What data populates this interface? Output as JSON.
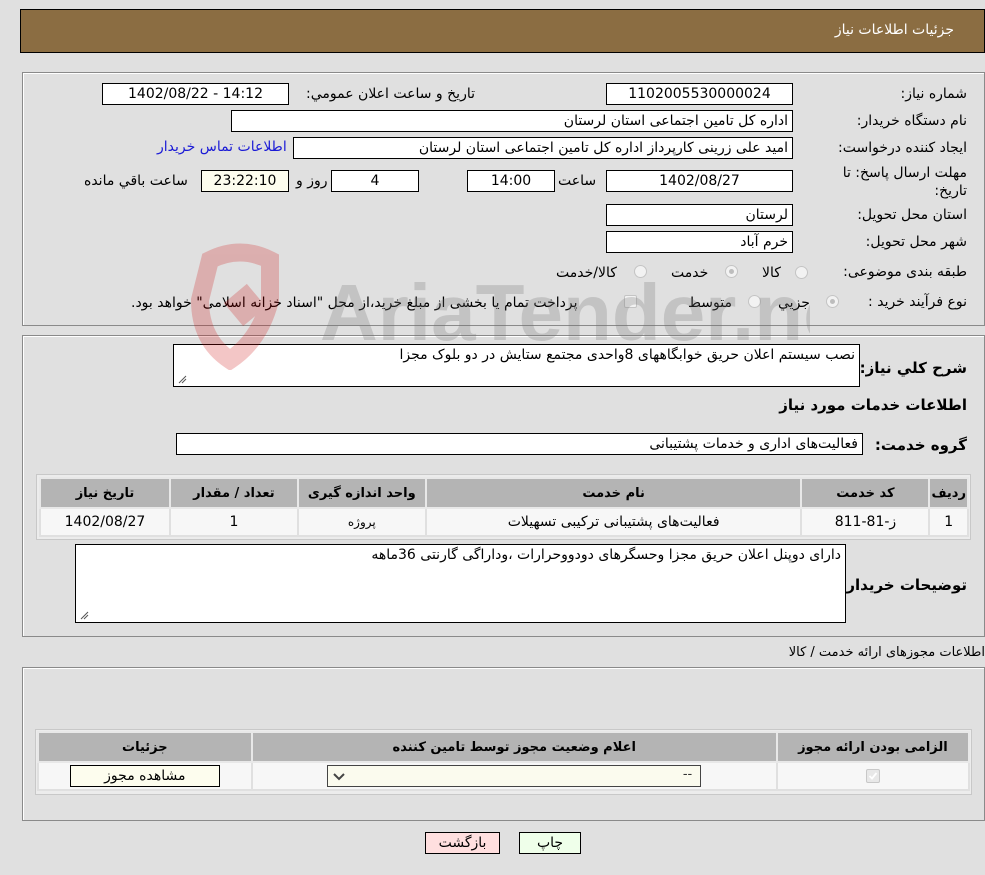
{
  "header": {
    "title": "جزئیات اطلاعات نیاز"
  },
  "form": {
    "need_number_label": "شماره نیاز:",
    "need_number": "1102005530000024",
    "announce_label": "تاریخ و ساعت اعلان عمومي:",
    "announce_value": "1402/08/22 - 14:12",
    "buyer_org_label": "نام دستگاه خريدار:",
    "buyer_org": "اداره کل تامین اجتماعی استان لرستان",
    "requester_label": "ايجاد کننده درخواست:",
    "requester": "امید علی زرینی کارپرداز اداره کل تامین اجتماعی استان لرستان",
    "buyer_contact_link": "اطلاعات تماس خريدار",
    "deadline_label": "مهلت ارسال پاسخ: تا تاریخ:",
    "deadline_date": "1402/08/27",
    "time_label": "ساعت",
    "deadline_time": "14:00",
    "days_value": "4",
    "days_label": "روز و",
    "remaining_time": "23:22:10",
    "remaining_label": "ساعت باقي مانده",
    "province_label": "استان محل تحويل:",
    "province": "لرستان",
    "city_label": "شهر محل تحويل:",
    "city": "خرم آباد",
    "category_label": "طبقه بندی موضوعی:",
    "category_options": [
      {
        "label": "کالا",
        "checked": false
      },
      {
        "label": "خدمت",
        "checked": true
      },
      {
        "label": "کالا/خدمت",
        "checked": false
      }
    ],
    "purchase_type_label": "نوع فرآيند خريد :",
    "purchase_options": [
      {
        "label": "جزيي",
        "checked": true
      },
      {
        "label": "متوسط",
        "checked": false
      }
    ],
    "treasury_note": "پرداخت تمام یا بخشی از مبلغ خرید،از محل \"اسناد خزانه اسلامی\" خواهد بود.",
    "treasury_checked": false
  },
  "details": {
    "summary_label": "شرح کلي نياز:",
    "summary": "نصب سیستم اعلان حریق خوابگاههای 8واحدی مجتمع ستایش در دو بلوک مجزا",
    "services_heading": "اطلاعات خدمات مورد نياز",
    "service_group_label": "گروه خدمت:",
    "service_group": "فعالیت‌های اداری و خدمات پشتیبانی",
    "table": {
      "headers": [
        "رديف",
        "کد خدمت",
        "نام خدمت",
        "واحد اندازه گيری",
        "تعداد / مقدار",
        "تاريخ نياز"
      ],
      "rows": [
        [
          "1",
          "ز-81-811",
          "فعالیت‌های پشتیبانی ترکیبی تسهیلات",
          "پروژه",
          "1",
          "1402/08/27"
        ]
      ]
    },
    "buyer_notes_label": "توضيحات خريدار:",
    "buyer_notes": "دارای دوپنل اعلان حریق مجزا وحسگرهای دودووحرارات ،وداراگی گارنتی 36ماهه"
  },
  "permits": {
    "heading": "اطلاعات مجوزهای ارائه خدمت / کالا",
    "headers": [
      "الزامی بودن ارائه مجوز",
      "اعلام وضعیت مجوز توسط تامين کننده",
      "جزئيات"
    ],
    "row": {
      "required_checked": true,
      "status_select": "--",
      "view_button": "مشاهده مجوز"
    }
  },
  "actions": {
    "print_label": "چاپ",
    "back_label": "بازگشت"
  },
  "watermark": {
    "text": "AriaTender.neT"
  }
}
